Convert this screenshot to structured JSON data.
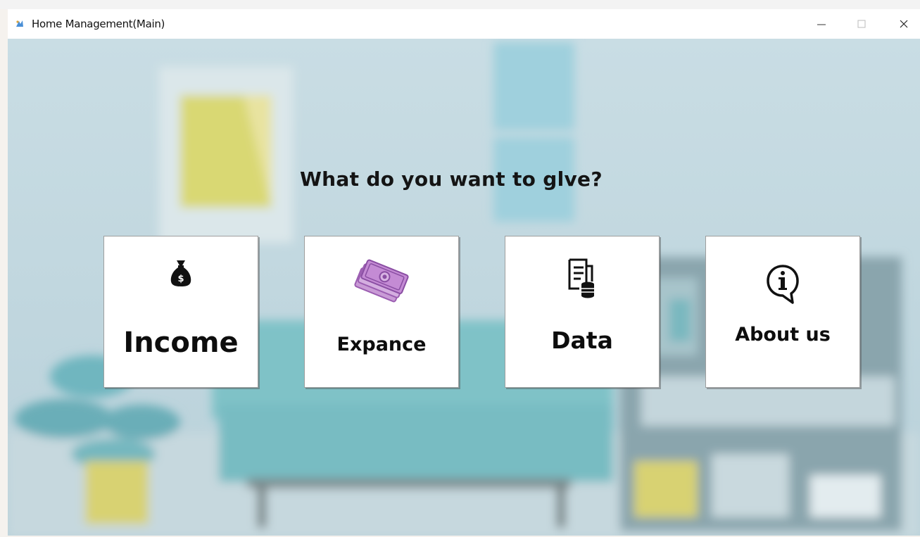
{
  "window": {
    "title": "Home Management(Main)"
  },
  "main": {
    "prompt": "What do you want to glve?",
    "tiles": [
      {
        "label": "Income",
        "icon": "money-bag-icon"
      },
      {
        "label": "Expance",
        "icon": "cash-notes-icon"
      },
      {
        "label": "Data",
        "icon": "document-database-icon"
      },
      {
        "label": "About us",
        "icon": "info-bubble-icon"
      }
    ]
  },
  "colors": {
    "background": "#bcd3dc",
    "tile": "#ffffff",
    "expance_icon": "#b97fc9",
    "text": "#0d0d0d"
  }
}
